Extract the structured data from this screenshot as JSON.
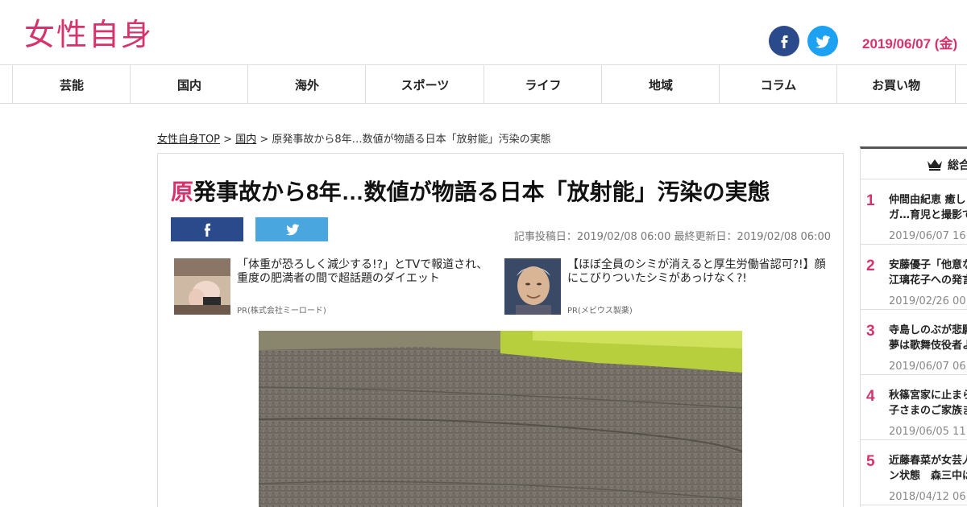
{
  "header": {
    "logo": "女性自身",
    "date": "2019/06/07 (金)"
  },
  "nav": [
    "芸能",
    "国内",
    "海外",
    "スポーツ",
    "ライフ",
    "地域",
    "コラム",
    "お買い物"
  ],
  "breadcrumb": {
    "home": "女性自身TOP",
    "sep1": " > ",
    "category": "国内",
    "sep2": " > ",
    "current": "原発事故から8年…数値が物語る日本「放射能」汚染の実態"
  },
  "article": {
    "title_first": "原",
    "title_rest": "発事故から8年…数値が物語る日本「放射能」汚染の実態",
    "meta": "記事投稿日：2019/02/08 06:00 最終更新日：2019/02/08 06:00"
  },
  "ads": [
    {
      "text": "「体重が恐ろしく減少する!?」とTVで報道され、重度の肥満者の間で超話題のダイエット",
      "pr": "PR(株式会社ミーロード)"
    },
    {
      "text": "【ほぼ全員のシミが消えると厚生労働省認可?!】顔にこびりついたシミがあっけなく?!",
      "pr": "PR(メビウス製薬)"
    }
  ],
  "sidebar": {
    "heading": "総合",
    "items": [
      {
        "num": "1",
        "line1": "仲間由紀恵 癒し",
        "line2": "ガ…育児と撮影で",
        "date": "2019/06/07 16:00"
      },
      {
        "num": "2",
        "line1": "安藤優子「他意な",
        "line2": "江璃花子への発言",
        "date": "2019/02/26 00:00"
      },
      {
        "num": "3",
        "line1": "寺島しのぶが悲願",
        "line2": "夢は歌舞伎役者よ",
        "date": "2019/06/07 06:00"
      },
      {
        "num": "4",
        "line1": "秋篠宮家に止まら",
        "line2": "子さまのご家族ま",
        "date": "2019/06/05 11:00"
      },
      {
        "num": "5",
        "line1": "近藤春菜が女芸人",
        "line2": "ン状態　森三中は",
        "date": "2018/04/12 06:00"
      }
    ]
  },
  "colors": {
    "accent": "#d6336c",
    "facebook": "#2b4a8c",
    "twitter": "#1da1f2"
  }
}
